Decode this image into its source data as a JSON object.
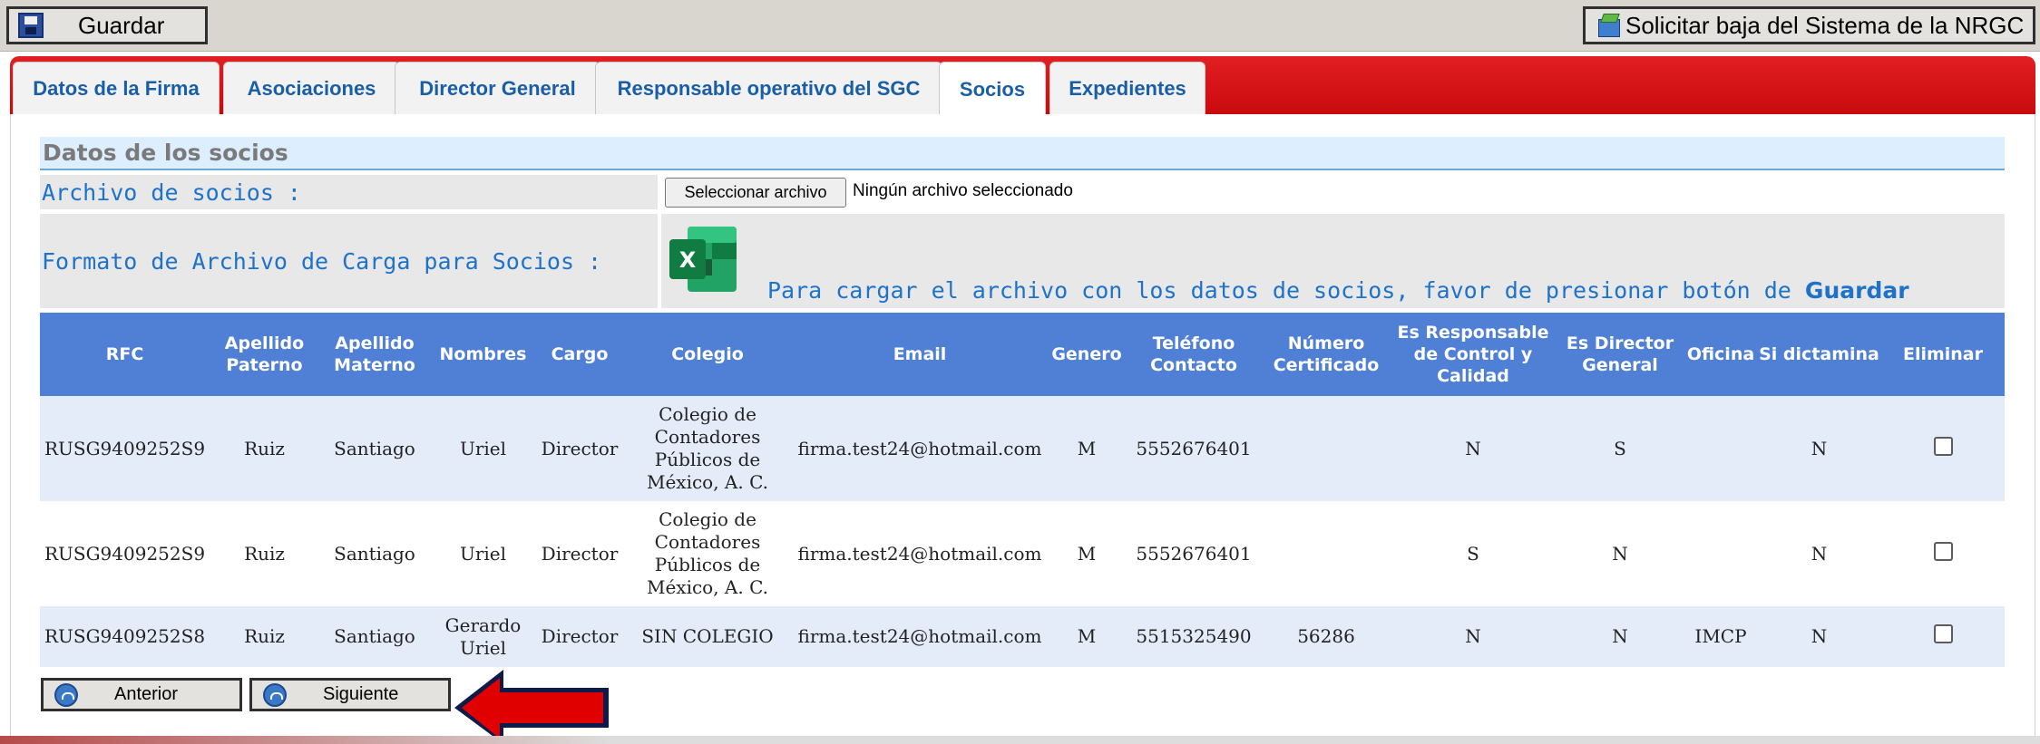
{
  "toolbar": {
    "save_label": "Guardar",
    "baja_label": "Solicitar baja del Sistema de la NRGC"
  },
  "tabs": [
    {
      "label": "Datos de la Firma"
    },
    {
      "label": "Asociaciones"
    },
    {
      "label": "Director General"
    },
    {
      "label": "Responsable operativo del SGC"
    },
    {
      "label": "Socios",
      "active": true
    },
    {
      "label": "Expedientes"
    }
  ],
  "section": {
    "title": "Datos de los socios",
    "file_label": "Archivo de socios :",
    "file_button": "Seleccionar archivo",
    "file_status": "Ningún archivo seleccionado",
    "format_label": "Formato de Archivo de Carga para Socios :",
    "format_icon": "excel-icon",
    "info_text": "Para cargar el archivo con los datos de socios, favor de presionar botón de",
    "info_bold": "Guardar"
  },
  "table": {
    "headers": [
      "RFC",
      "Apellido Paterno",
      "Apellido Materno",
      "Nombres",
      "Cargo",
      "Colegio",
      "Email",
      "Genero",
      "Teléfono Contacto",
      "Número Certificado",
      "Es Responsable de Control y Calidad",
      "Es Director General",
      "Oficina",
      "Si dictamina",
      "Eliminar"
    ],
    "rows": [
      {
        "rfc": "RUSG9409252S9",
        "paterno": "Ruiz",
        "materno": "Santiago",
        "nombres": "Uriel",
        "cargo": "Director",
        "colegio": "Colegio de Contadores Públicos de México, A. C.",
        "email": "firma.test24@hotmail.com",
        "genero": "M",
        "telefono": "5552676401",
        "certificado": "",
        "responsable": "N",
        "director": "S",
        "oficina": "",
        "dictamina": "N"
      },
      {
        "rfc": "RUSG9409252S9",
        "paterno": "Ruiz",
        "materno": "Santiago",
        "nombres": "Uriel",
        "cargo": "Director",
        "colegio": "Colegio de Contadores Públicos de México, A. C.",
        "email": "firma.test24@hotmail.com",
        "genero": "M",
        "telefono": "5552676401",
        "certificado": "",
        "responsable": "S",
        "director": "N",
        "oficina": "",
        "dictamina": "N"
      },
      {
        "rfc": "RUSG9409252S8",
        "paterno": "Ruiz",
        "materno": "Santiago",
        "nombres": "Gerardo Uriel",
        "cargo": "Director",
        "colegio": "SIN COLEGIO",
        "email": "firma.test24@hotmail.com",
        "genero": "M",
        "telefono": "5515325490",
        "certificado": "56286",
        "responsable": "N",
        "director": "N",
        "oficina": "IMCP",
        "dictamina": "N"
      }
    ]
  },
  "nav": {
    "prev_label": "Anterior",
    "next_label": "Siguiente"
  },
  "colors": {
    "tab_bar": "#d70f12",
    "header_bg": "#4f80d6",
    "label_text": "#1e73c8",
    "arrow": "#e00000"
  }
}
